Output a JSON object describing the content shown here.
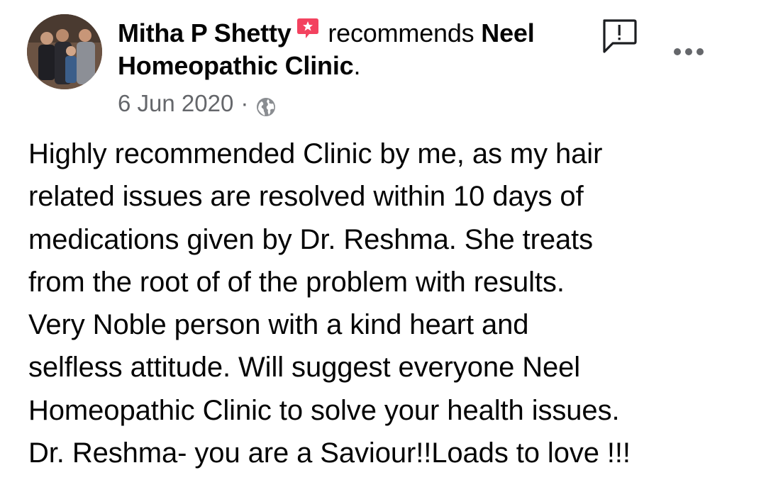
{
  "post": {
    "author": "Mitha P Shetty",
    "action": "recommends",
    "page": "Neel Homeopathic Clinic",
    "page_suffix": ".",
    "date": "6 Jun 2020",
    "separator": "·",
    "privacy_icon": "globe-icon",
    "recommend_icon": "recommendation-flag-icon",
    "report_icon": "report-speech-bubble-icon",
    "more_icon": "more-options-icon",
    "body": "Highly recommended Clinic by me, as my hair\nrelated issues are resolved within 10 days of\nmedications given by Dr. Reshma. She treats\nfrom the root of of the  problem with results.\nVery Noble person with a  kind heart and\nselfless attitude. Will suggest everyone Neel\nHomeopathic Clinic to solve your  health issues.\nDr. Reshma- you are a Saviour!!Loads to love !!!"
  },
  "colors": {
    "recommend_badge": "#f3425f",
    "secondary_text": "#65676b",
    "primary_text": "#050505"
  }
}
